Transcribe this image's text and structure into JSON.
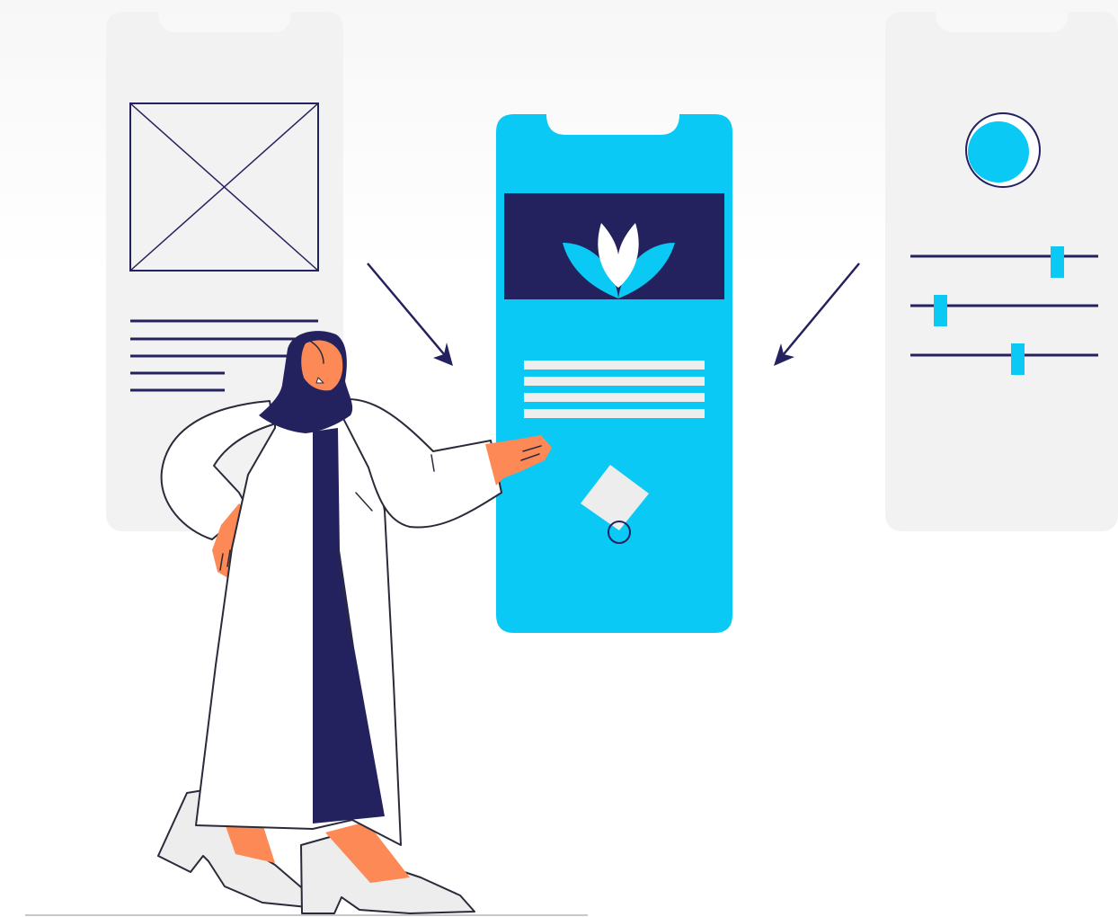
{
  "colors": {
    "background_top": "#f7f7f7",
    "background_bottom": "#ffffff",
    "wireframe_phone": "#f2f2f2",
    "navy": "#24225e",
    "cyan": "#0ac9f4",
    "skin": "#fd8a56",
    "coat": "#ffffff",
    "outline": "#2b2a3a",
    "light_gray": "#ededed"
  },
  "illustration": {
    "subject": "wireframes-to-app-design",
    "left_phone": {
      "image_placeholder": "crossed-box",
      "text_lines": 5
    },
    "center_phone": {
      "banner_icon": "lotus-icon",
      "text_lines": 4,
      "cursor_icon": "pointer-icon"
    },
    "right_phone": {
      "avatar_icon": "avatar-circle-icon",
      "slider_levels": [
        0.78,
        0.16,
        0.57
      ]
    },
    "arrows": [
      "left-to-center",
      "right-to-center"
    ],
    "character": "woman-in-white-coat-presenting"
  }
}
